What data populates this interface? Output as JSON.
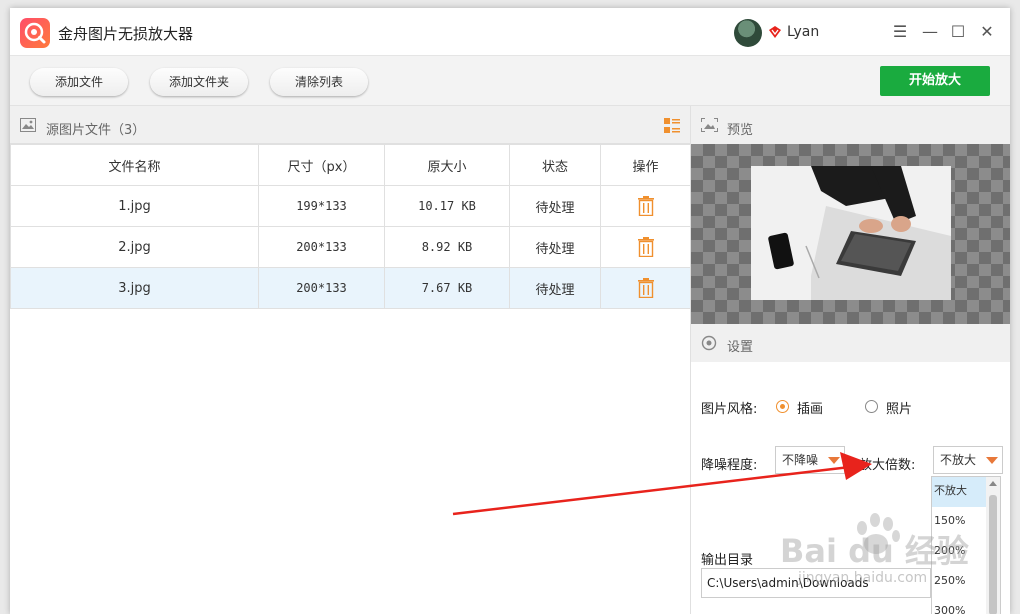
{
  "app": {
    "title": "金舟图片无损放大器",
    "user": "Lyan"
  },
  "window_controls": {
    "menu": "☰",
    "minimize": "—",
    "maximize": "☐",
    "close": "✕"
  },
  "toolbar": {
    "add_file": "添加文件",
    "add_folder": "添加文件夹",
    "clear_list": "清除列表",
    "start": "开始放大"
  },
  "source": {
    "title": "源图片文件（3）",
    "columns": [
      "文件名称",
      "尺寸（px）",
      "原大小",
      "状态",
      "操作"
    ],
    "rows": [
      {
        "name": "1.jpg",
        "size": "199*133",
        "filesize": "10.17 KB",
        "status": "待处理"
      },
      {
        "name": "2.jpg",
        "size": "200*133",
        "filesize": "8.92 KB",
        "status": "待处理"
      },
      {
        "name": "3.jpg",
        "size": "200*133",
        "filesize": "7.67 KB",
        "status": "待处理"
      }
    ]
  },
  "preview": {
    "title": "预览"
  },
  "settings": {
    "title": "设置",
    "style_label": "图片风格:",
    "style_options": [
      "插画",
      "照片"
    ],
    "style_selected": "插画",
    "noise_label": "降噪程度:",
    "noise_value": "不降噪",
    "scale_label": "放大倍数:",
    "scale_value": "不放大",
    "scale_options": [
      "不放大",
      "150%",
      "200%",
      "250%",
      "300%"
    ],
    "output_label": "输出目录",
    "output_path": "C:\\Users\\admin\\Downloads"
  },
  "watermark": {
    "text": "Bai du 经验",
    "url": "jingyan.baidu.com"
  },
  "colors": {
    "accent_green": "#1aab3f",
    "accent_orange": "#f0902e",
    "selected_row": "#e9f4fc",
    "arrow_red": "#e8231c"
  }
}
